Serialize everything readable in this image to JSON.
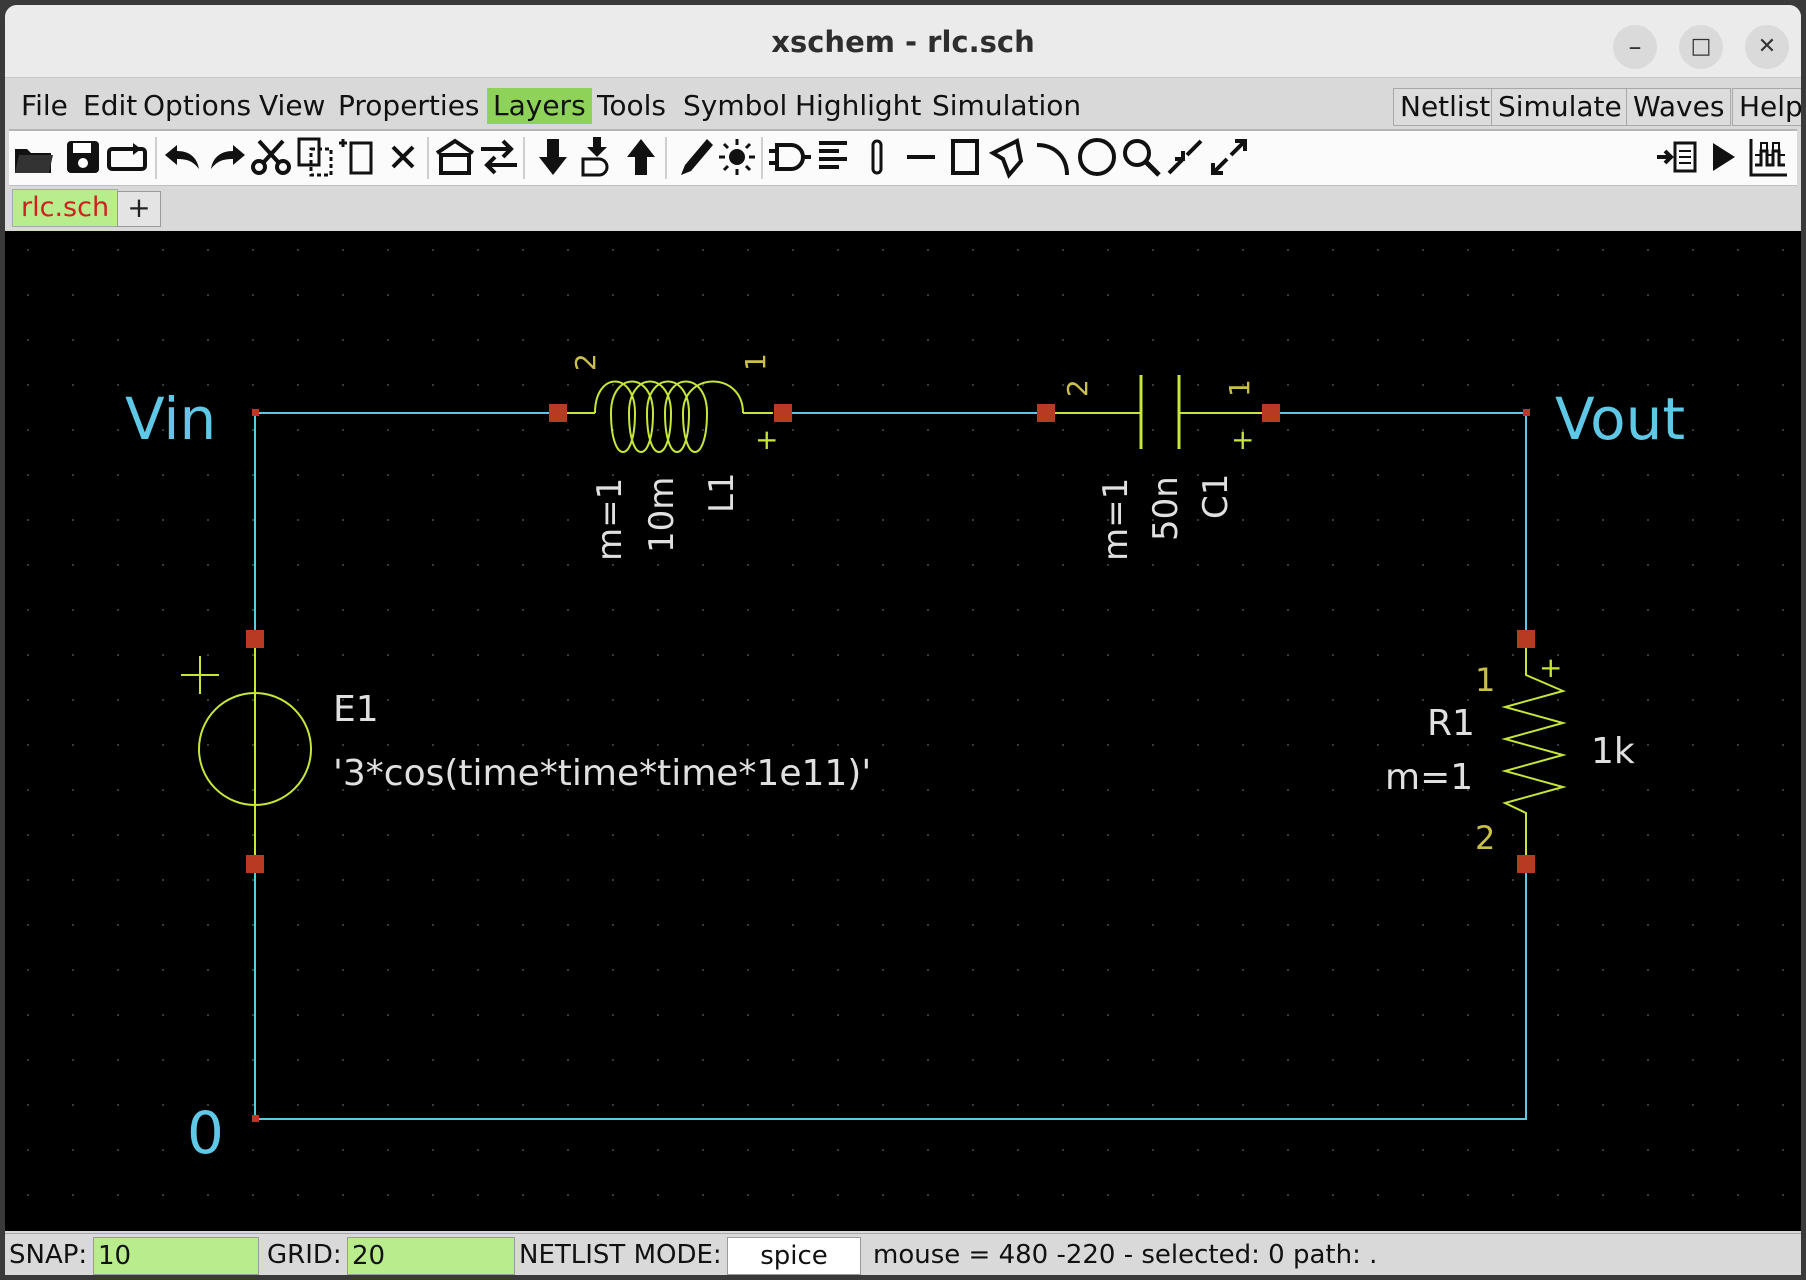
{
  "window": {
    "title": "xschem - rlc.sch",
    "minimize": "–",
    "maximize": "□",
    "close": "✕"
  },
  "menubar": {
    "left": [
      "File",
      "Edit",
      "Options",
      "View",
      "Properties",
      "Layers",
      "Tools",
      "Symbol",
      "Highlight",
      "Simulation"
    ],
    "active": "Layers",
    "right": [
      "Netlist",
      "Simulate",
      "Waves",
      "Help"
    ]
  },
  "toolbar": {
    "icons": [
      "open-icon",
      "save-icon",
      "reload-icon",
      "undo-icon",
      "redo-icon",
      "cut-icon",
      "copy-icon",
      "move-icon",
      "delete-icon",
      "push-hierarchy-icon",
      "swap-icon",
      "descend-icon",
      "descend-symbol-icon",
      "ascend-icon",
      "draw-wire-icon",
      "highlight-icon",
      "insert-symbol-icon",
      "text-icon",
      "pin-icon",
      "line-icon",
      "rectangle-icon",
      "polygon-icon",
      "arc-icon",
      "circle-icon",
      "zoom-icon",
      "zoom-in-icon",
      "zoom-full-icon",
      "netlist-icon",
      "simulate-icon",
      "waves-icon"
    ]
  },
  "tabs": {
    "active": "rlc.sch",
    "add": "+"
  },
  "schematic": {
    "nets": {
      "vin": "Vin",
      "vout": "Vout",
      "ground": "0"
    },
    "inductor": {
      "name": "L1",
      "value": "10m",
      "mult": "m=1",
      "pin_left": "2",
      "pin_right": "1"
    },
    "capacitor": {
      "name": "C1",
      "value": "50n",
      "mult": "m=1",
      "pin_left": "2",
      "pin_right": "1"
    },
    "source": {
      "name": "E1",
      "expr": "'3*cos(time*time*time*1e11)'"
    },
    "resistor": {
      "name": "R1",
      "value": "1k",
      "mult": "m=1",
      "pin_top": "1",
      "pin_bottom": "2"
    },
    "plus": "+",
    "colors": {
      "wire": "#5ec8e6",
      "symbol": "#c6e63a",
      "pin": "#b83a22",
      "pin_label": "#c8c04a",
      "text": "#e0e0e0",
      "grid": "#2a2a2a"
    }
  },
  "statusbar": {
    "snap_label": "SNAP:",
    "snap_value": "10",
    "grid_label": "GRID:",
    "grid_value": "20",
    "mode_label": "NETLIST MODE:",
    "mode_value": "spice",
    "info": "mouse = 480 -220 - selected: 0 path: ."
  }
}
